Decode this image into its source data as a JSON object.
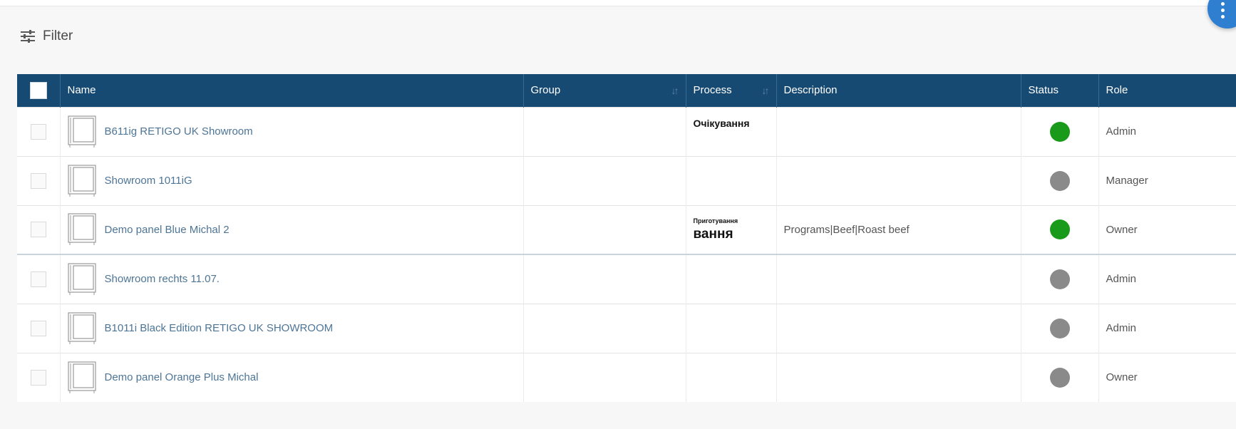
{
  "toolbar": {
    "filter_label": "Filter"
  },
  "colors": {
    "header_bg": "#174a73",
    "status_online": "#1a9a1a",
    "status_offline": "#8a8a8a",
    "fab": "#2f7fd1"
  },
  "table": {
    "columns": {
      "name": "Name",
      "group": "Group",
      "process": "Process",
      "description": "Description",
      "status": "Status",
      "role": "Role"
    },
    "rows": [
      {
        "name": "B611ig RETIGO UK Showroom",
        "group": "",
        "process": "Очікування",
        "description": "",
        "status": "online",
        "role": "Admin"
      },
      {
        "name": "Showroom 1011iG",
        "group": "",
        "process": "",
        "description": "",
        "status": "offline",
        "role": "Manager"
      },
      {
        "name": "Demo panel Blue Michal 2",
        "group": "",
        "process_small": "Приготування",
        "process_big": "вання",
        "description": "Programs|Beef|Roast beef",
        "status": "online",
        "role": "Owner"
      },
      {
        "name": "Showroom rechts 11.07.",
        "group": "",
        "process": "",
        "description": "",
        "status": "offline",
        "role": "Admin"
      },
      {
        "name": "B1011i Black Edition RETIGO UK SHOWROOM",
        "group": "",
        "process": "",
        "description": "",
        "status": "offline",
        "role": "Admin"
      },
      {
        "name": "Demo panel Orange Plus Michal",
        "group": "",
        "process": "",
        "description": "",
        "status": "offline",
        "role": "Owner"
      }
    ]
  }
}
